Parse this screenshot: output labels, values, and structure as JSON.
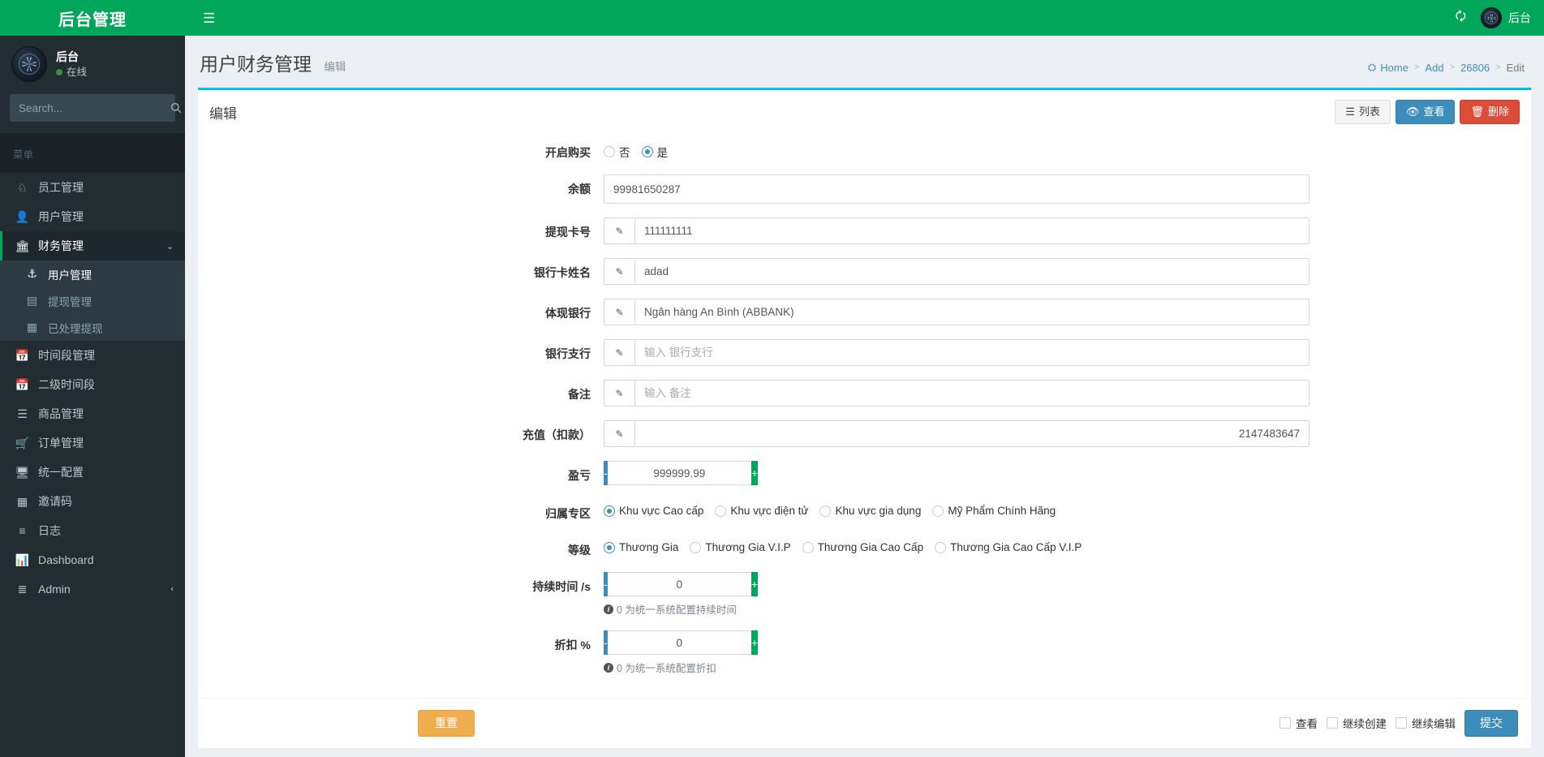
{
  "brand": {
    "title": "后台管理"
  },
  "sidebar": {
    "user": {
      "name": "后台",
      "status": "在线"
    },
    "search": {
      "placeholder": "Search...",
      "value": "",
      "icon": "search-icon"
    },
    "menu_header": "菜单",
    "items": [
      {
        "label": "员工管理",
        "icon": "employee-icon",
        "glyph": "♨"
      },
      {
        "label": "用户管理",
        "icon": "user-icon",
        "glyph": "♟"
      },
      {
        "label": "财务管理",
        "icon": "bank-icon",
        "glyph": "ἽB",
        "active": true,
        "caret": "⌄",
        "children": [
          {
            "label": "用户管理",
            "icon": "anchor-icon",
            "glyph": "⚓",
            "active": true
          },
          {
            "label": "提现管理",
            "icon": "card-icon",
            "glyph": "▤"
          },
          {
            "label": "已处理提现",
            "icon": "building-icon",
            "glyph": "▦"
          }
        ]
      },
      {
        "label": "时间段管理",
        "icon": "calendar-icon",
        "glyph": "Ὕ3"
      },
      {
        "label": "二级时间段",
        "icon": "calendar-check-icon",
        "glyph": "Ὄ5"
      },
      {
        "label": "商品管理",
        "icon": "database-icon",
        "glyph": "☰"
      },
      {
        "label": "订单管理",
        "icon": "cart-icon",
        "glyph": "Ὥ2"
      },
      {
        "label": "统一配置",
        "icon": "monitor-icon",
        "glyph": "▭"
      },
      {
        "label": "邀请码",
        "icon": "building-icon",
        "glyph": "▦"
      },
      {
        "label": "日志",
        "icon": "list-icon",
        "glyph": "≡"
      },
      {
        "label": "Dashboard",
        "icon": "chart-bar-icon",
        "glyph": "█"
      },
      {
        "label": "Admin",
        "icon": "sliders-icon",
        "glyph": "≡",
        "caret": "‹"
      }
    ]
  },
  "topbar": {
    "menu_toggle_icon": "hamburger-icon",
    "refresh_icon": "refresh-icon",
    "user_label": "后台"
  },
  "page": {
    "title": "用户财务管理",
    "subtitle": "编辑",
    "breadcrumb": [
      {
        "label": "Home",
        "icon": "dashboard-icon"
      },
      {
        "label": "Add"
      },
      {
        "label": "26806"
      },
      {
        "label": "Edit"
      }
    ]
  },
  "card": {
    "title": "编辑",
    "buttons": [
      {
        "label": "列表",
        "icon": "list-icon",
        "style": "default"
      },
      {
        "label": "查看",
        "icon": "eye-icon",
        "style": "info"
      },
      {
        "label": "删除",
        "icon": "trash-icon",
        "style": "danger"
      }
    ]
  },
  "form": {
    "enable_purchase": {
      "label": "开启购买",
      "options": [
        {
          "label": "否",
          "checked": false
        },
        {
          "label": "是",
          "checked": true
        }
      ]
    },
    "balance": {
      "label": "余额",
      "value": "99981650287",
      "placeholder": ""
    },
    "card_number": {
      "label": "提现卡号",
      "value": "111111111",
      "placeholder": "",
      "icon": "pencil-icon"
    },
    "card_name": {
      "label": "银行卡姓名",
      "value": "adad",
      "placeholder": "",
      "icon": "pencil-icon"
    },
    "bank": {
      "label": "体现银行",
      "value": "Ngân hàng An Bình (ABBANK)",
      "placeholder": "",
      "icon": "pencil-icon"
    },
    "branch": {
      "label": "银行支行",
      "value": "",
      "placeholder": "输入 银行支行",
      "icon": "pencil-icon"
    },
    "remark": {
      "label": "备注",
      "value": "",
      "placeholder": "输入 备注",
      "icon": "pencil-icon"
    },
    "recharge": {
      "label": "充值（扣款）",
      "value": "2147483647",
      "placeholder": "",
      "icon": "pencil-icon"
    },
    "profit_loss": {
      "label": "盈亏",
      "value": "999999.99",
      "minus": "-",
      "plus": "+"
    },
    "zone": {
      "label": "归属专区",
      "options": [
        {
          "label": "Khu vực Cao cấp",
          "checked": true
        },
        {
          "label": "Khu vực điện tử",
          "checked": false
        },
        {
          "label": "Khu vực gia dụng",
          "checked": false
        },
        {
          "label": "Mỹ Phẩm Chính Hãng",
          "checked": false
        }
      ]
    },
    "level": {
      "label": "等级",
      "options": [
        {
          "label": "Thương Gia",
          "checked": true
        },
        {
          "label": "Thương Gia V.I.P",
          "checked": false
        },
        {
          "label": "Thương Gia Cao Cấp",
          "checked": false
        },
        {
          "label": "Thương Gia Cao Cấp V.I.P",
          "checked": false
        }
      ]
    },
    "duration": {
      "label": "持续时间 /s",
      "value": "0",
      "minus": "-",
      "plus": "+",
      "help": "0 为统一系统配置持续时间"
    },
    "discount": {
      "label": "折扣 %",
      "value": "0",
      "minus": "-",
      "plus": "+",
      "help": "0 为统一系统配置折扣"
    }
  },
  "footer": {
    "reset_label": "重置",
    "checkboxes": [
      {
        "label": "查看",
        "checked": false
      },
      {
        "label": "继续创建",
        "checked": false
      },
      {
        "label": "继续编辑",
        "checked": false
      }
    ],
    "submit_label": "提交"
  },
  "colors": {
    "brand_green": "#00a65a",
    "sidebar_dark": "#222d32",
    "card_accent": "#00c0ef",
    "info_blue": "#3c8dbc",
    "danger_red": "#dd4b39",
    "warning_orange": "#f0ad4e"
  }
}
